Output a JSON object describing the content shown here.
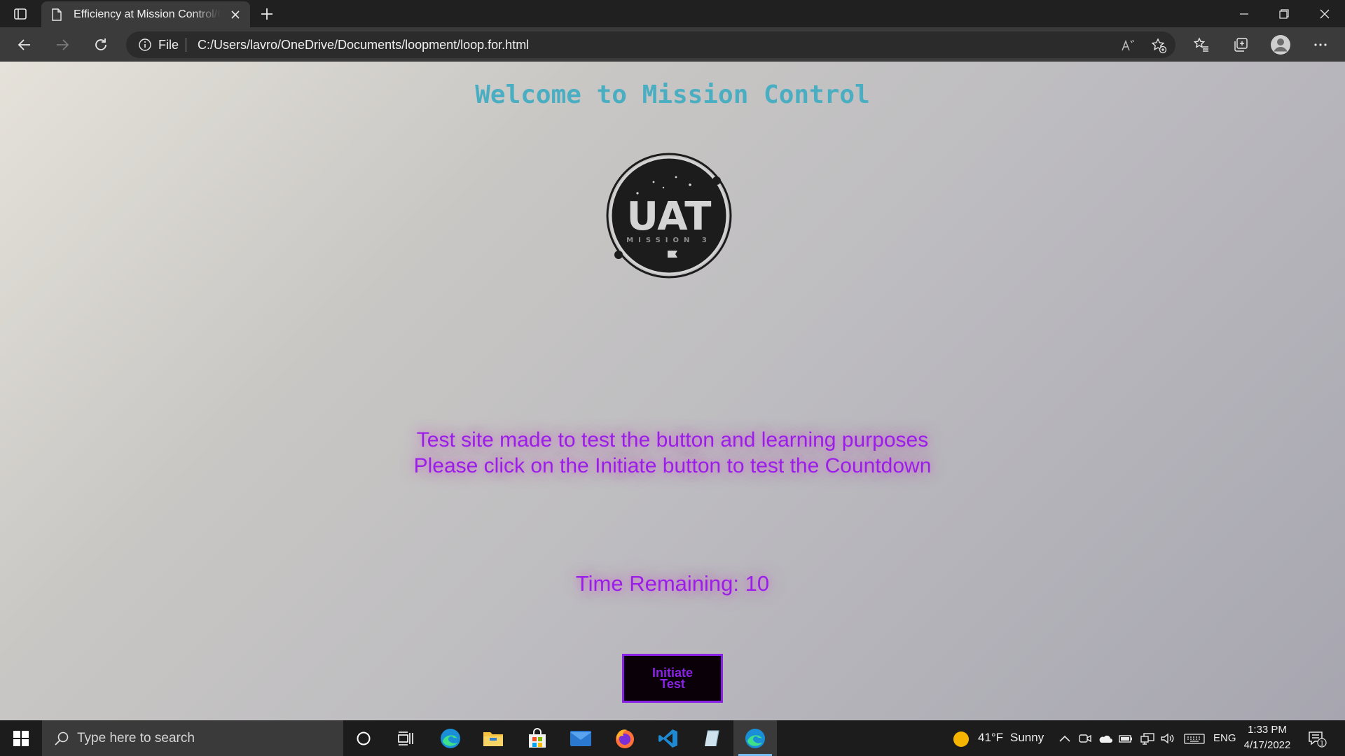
{
  "browser": {
    "tab_title": "Efficiency at Mission Control/Challenge",
    "address_scheme": "File",
    "address_url": "C:/Users/lavro/OneDrive/Documents/loopment/loop.for.html"
  },
  "page": {
    "welcome": "Welcome to Mission Control",
    "logo_text": "UAT",
    "logo_subtext": "MISSION 3",
    "description_line1": "Test site made to test the button and learning purposes",
    "description_line2": "Please click on the Initiate button to test the Countdown",
    "timer_label": "Time Remaining: 10",
    "initiate_button_label": "Initiate Test"
  },
  "taskbar": {
    "search_placeholder": "Type here to search",
    "weather_temp": "41°F",
    "weather_desc": "Sunny",
    "language": "ENG",
    "time": "1:33 PM",
    "date": "4/17/2022",
    "notification_count": "1"
  },
  "colors": {
    "welcome": "#4aaec3",
    "accent_purple": "#9b1ee8",
    "button_border": "#8a22e6",
    "browser_frame": "#202020",
    "toolbar": "#3b3b3b"
  },
  "icons": {
    "tab_actions": "tab-actions-icon",
    "favicon": "document-icon",
    "close_tab": "close-icon",
    "new_tab": "plus-icon",
    "back": "arrow-left-icon",
    "forward": "arrow-right-icon",
    "refresh": "refresh-icon",
    "site_info": "info-icon",
    "read_aloud": "read-aloud-icon",
    "add_favorite": "star-plus-icon",
    "favorites": "favorites-icon",
    "collections": "collections-icon",
    "profile": "profile-icon",
    "more": "more-icon"
  }
}
